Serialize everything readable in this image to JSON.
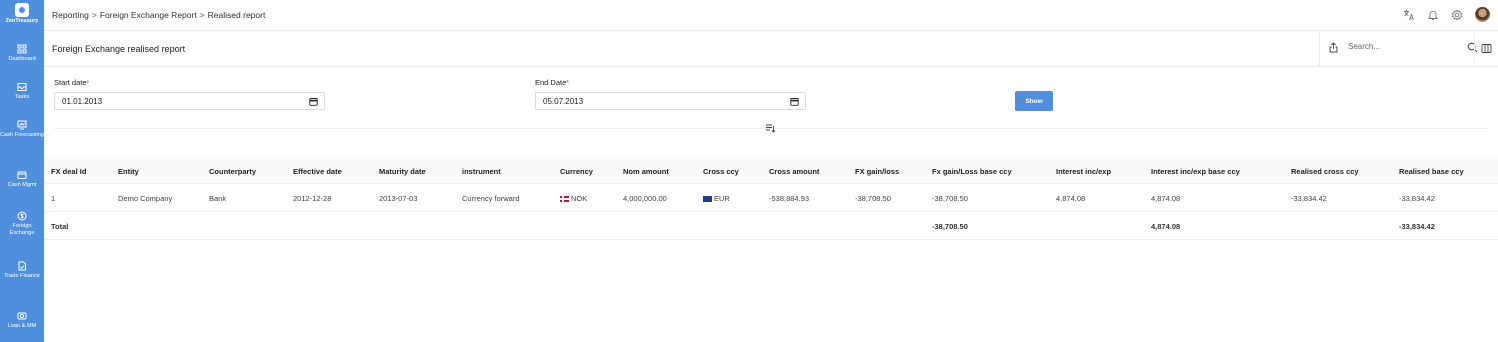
{
  "app": {
    "name": "ZenTreasury"
  },
  "sidebar": {
    "items": [
      {
        "label": "Dashboard",
        "icon": "dashboard-icon"
      },
      {
        "label": "Tasks",
        "icon": "inbox-icon"
      },
      {
        "label": "Cash Forecasting",
        "icon": "forecast-icon"
      },
      {
        "label": "Cash Mgmt",
        "icon": "wallet-icon"
      },
      {
        "label": "Foreign Exchange",
        "icon": "dollar-icon"
      },
      {
        "label": "Trade Finance",
        "icon": "document-icon"
      },
      {
        "label": "Loan & MM",
        "icon": "loan-icon"
      }
    ]
  },
  "breadcrumb": [
    "Reporting",
    "Foreign Exchange Report",
    "Realised report"
  ],
  "header_icons": [
    "translate-icon",
    "bell-icon",
    "gear-icon",
    "avatar"
  ],
  "page": {
    "title": "Foreign Exchange realised report"
  },
  "search": {
    "placeholder": "Search..."
  },
  "form": {
    "start_label": "Start date",
    "start_value": "01.01.2013",
    "end_label": "End Date",
    "end_value": "05.07.2013",
    "required_mark": "*",
    "show_button": "Show"
  },
  "table": {
    "columns": [
      "FX deal Id",
      "Entity",
      "Counterparty",
      "Effective date",
      "Maturity date",
      "instrument",
      "Currency",
      "Nom amount",
      "Cross ccy",
      "Cross amount",
      "FX gain/loss",
      "Fx gain/Loss base ccy",
      "Interest inc/exp",
      "Interest inc/exp base ccy",
      "Realised cross ccy",
      "Realised base ccy"
    ],
    "rows": [
      [
        "1",
        "Demo Company",
        "Bank",
        "2012-12-28",
        "2013-07-03",
        "Currency forward",
        "NOK",
        "4,000,000.00",
        "EUR",
        "-538,884.93",
        "-38,708.50",
        "-38,708.50",
        "4,874.08",
        "4,874.08",
        "-33,834.42",
        "-33,834.42"
      ]
    ],
    "total": {
      "label": "Total",
      "fx_gain_loss_base": "-38,708.50",
      "interest_base": "4,874.08",
      "realised_base": "-33,834.42"
    }
  },
  "colors": {
    "accent": "#4f8fde",
    "required": "#e03131"
  }
}
